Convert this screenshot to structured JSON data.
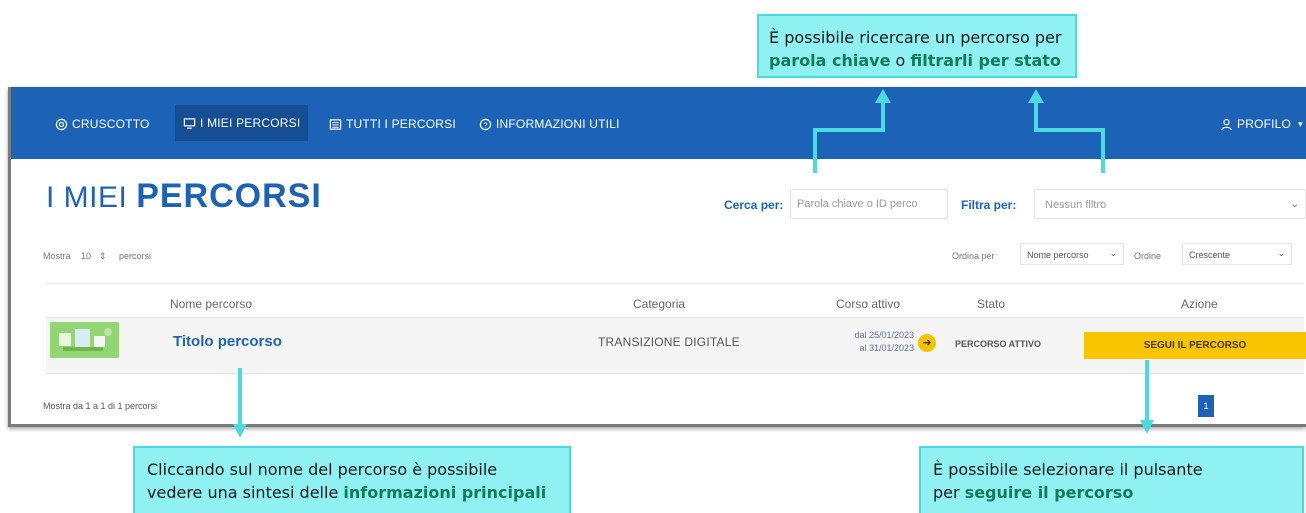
{
  "nav": {
    "items": [
      {
        "label": "CRUSCOTTO",
        "icon": "target-icon"
      },
      {
        "label": "I MIEI PERCORSI",
        "icon": "monitor-icon"
      },
      {
        "label": "TUTTI I PERCORSI",
        "icon": "list-icon"
      },
      {
        "label": "INFORMAZIONI UTILI",
        "icon": "help-circle-icon"
      }
    ],
    "profile": "PROFILO",
    "profile_caret": "▾"
  },
  "page": {
    "title_light": "I MIEI",
    "title_bold": "PERCORSI"
  },
  "search": {
    "label": "Cerca per:",
    "placeholder": "Parola chiave o ID perco"
  },
  "filter": {
    "label": "Filtra per:",
    "value": "Nessun filtro"
  },
  "show": {
    "prefix": "Mostra",
    "value": "10",
    "stepper": "⇕",
    "suffix": "percorsi"
  },
  "sort": {
    "order_by_label": "Ordina per",
    "order_by_value": "Nome percorso",
    "order_label": "Ordine",
    "order_value": "Crescente"
  },
  "table": {
    "headers": [
      "Nome percorso",
      "Categoria",
      "Corso attivo",
      "Stato",
      "Azione"
    ],
    "row": {
      "title": "Titolo percorso",
      "category": "TRANSIZIONE DIGITALE",
      "date_from": "dal 25/01/2023",
      "date_to": "al 31/01/2023",
      "status": "PERCORSO ATTIVO",
      "action": "SEGUI IL PERCORSO"
    }
  },
  "footer": {
    "summary": "Mostra da 1 a 1 di 1 percorsi",
    "page": "1"
  },
  "callouts": {
    "search": {
      "line1": "È possibile ricercare un percorso per",
      "hl1": "parola chiave",
      "mid": " o ",
      "hl2": "filtrarli per stato"
    },
    "title": {
      "line1": "Cliccando sul nome del percorso è possibile",
      "line2": "vedere una sintesi delle ",
      "hl": "informazioni principali"
    },
    "action": {
      "line1": "È possibile selezionare il pulsante",
      "line2": "per ",
      "hl": "seguire il percorso"
    }
  },
  "colors": {
    "nav_blue": "#1c63b8",
    "cta_yellow": "#f9c400",
    "callout_bg": "#8ff1f1",
    "arrow_cyan": "#4bdadd",
    "highlight_green": "#117d58"
  }
}
